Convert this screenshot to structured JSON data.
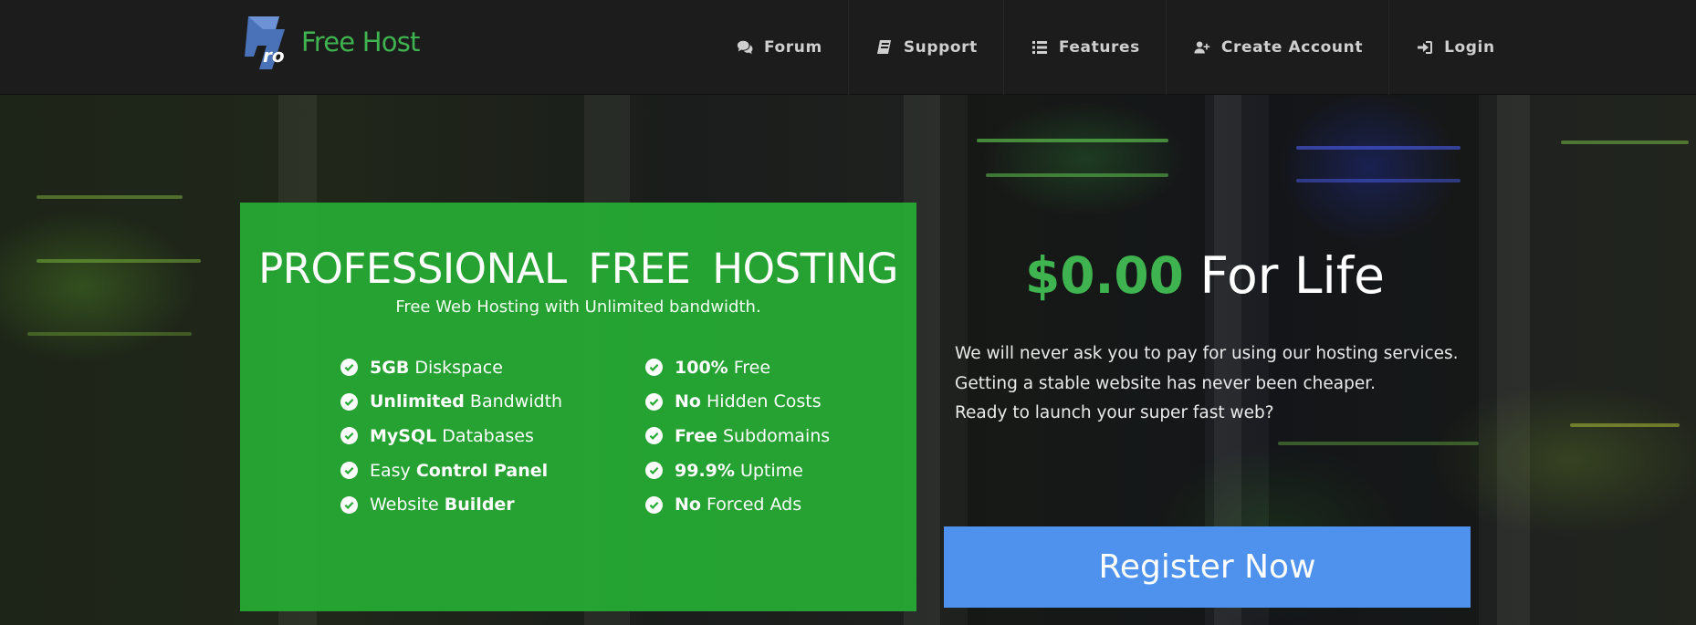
{
  "header": {
    "brand_name": "Free Host",
    "logo_glyph": "ro",
    "nav": [
      {
        "label": "Forum",
        "icon": "comments-icon"
      },
      {
        "label": "Support",
        "icon": "book-icon"
      },
      {
        "label": "Features",
        "icon": "list-icon"
      },
      {
        "label": "Create Account",
        "icon": "user-plus-icon"
      },
      {
        "label": "Login",
        "icon": "sign-in-icon"
      }
    ]
  },
  "promo": {
    "title": "PROFESSIONAL FREE HOSTING",
    "subtitle": "Free Web Hosting with Unlimited bandwidth.",
    "features_left": [
      {
        "pre": "",
        "bold": "5GB",
        "post": " Diskspace"
      },
      {
        "pre": "",
        "bold": "Unlimited",
        "post": " Bandwidth"
      },
      {
        "pre": "",
        "bold": "MySQL",
        "post": " Databases"
      },
      {
        "pre": "Easy ",
        "bold": "Control Panel",
        "post": ""
      },
      {
        "pre": "Website ",
        "bold": "Builder",
        "post": ""
      }
    ],
    "features_right": [
      {
        "pre": "",
        "bold": "100%",
        "post": " Free"
      },
      {
        "pre": "",
        "bold": "No",
        "post": " Hidden Costs"
      },
      {
        "pre": "",
        "bold": "Free",
        "post": " Subdomains"
      },
      {
        "pre": "",
        "bold": "99.9%",
        "post": " Uptime"
      },
      {
        "pre": "",
        "bold": "No",
        "post": " Forced Ads"
      }
    ]
  },
  "offer": {
    "price": "$0.00",
    "price_suffix": " For Life",
    "lines": [
      "We will never ask you to pay for using our hosting services.",
      "Getting a stable website has never been cheaper.",
      "Ready to launch your super fast web?"
    ],
    "cta_label": "Register Now"
  },
  "colors": {
    "brand_green": "#3fb34f",
    "promo_green": "#26ac34",
    "cta_blue": "#4f92ee",
    "header_bg": "#1c1c1c"
  }
}
